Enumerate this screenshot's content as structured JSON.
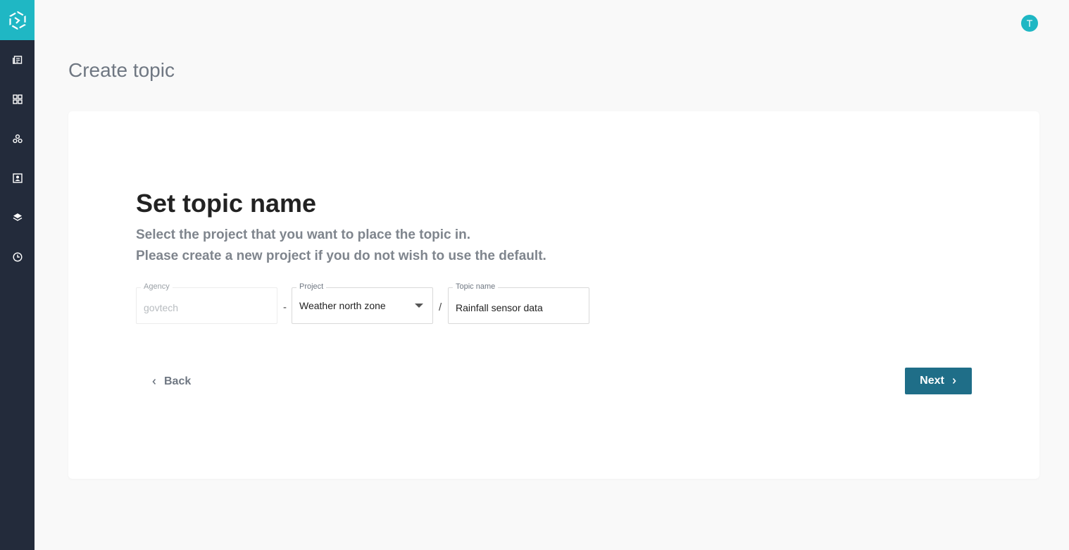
{
  "app": {
    "brand_color": "#1fb7c4",
    "sidebar_color": "#232b3b",
    "accent_color": "#1f6e88"
  },
  "sidebar": {
    "logo_icon": "hexagon-logo-icon",
    "items": [
      {
        "icon": "news-icon"
      },
      {
        "icon": "grid-icon"
      },
      {
        "icon": "cluster-icon"
      },
      {
        "icon": "contact-card-icon"
      },
      {
        "icon": "layers-icon"
      },
      {
        "icon": "clock-icon"
      }
    ]
  },
  "header": {
    "avatar_initial": "T"
  },
  "page": {
    "title": "Create topic"
  },
  "form": {
    "heading": "Set topic name",
    "subtitle_line1": "Select the project that you want to place the topic in.",
    "subtitle_line2": "Please create a new project if you do not wish to use the default.",
    "agency": {
      "label": "Agency",
      "value": "govtech"
    },
    "separator1": "-",
    "project": {
      "label": "Project",
      "value": "Weather north zone"
    },
    "separator2": "/",
    "topic_name": {
      "label": "Topic name",
      "value": "Rainfall sensor data"
    }
  },
  "actions": {
    "back_label": "Back",
    "next_label": "Next"
  }
}
